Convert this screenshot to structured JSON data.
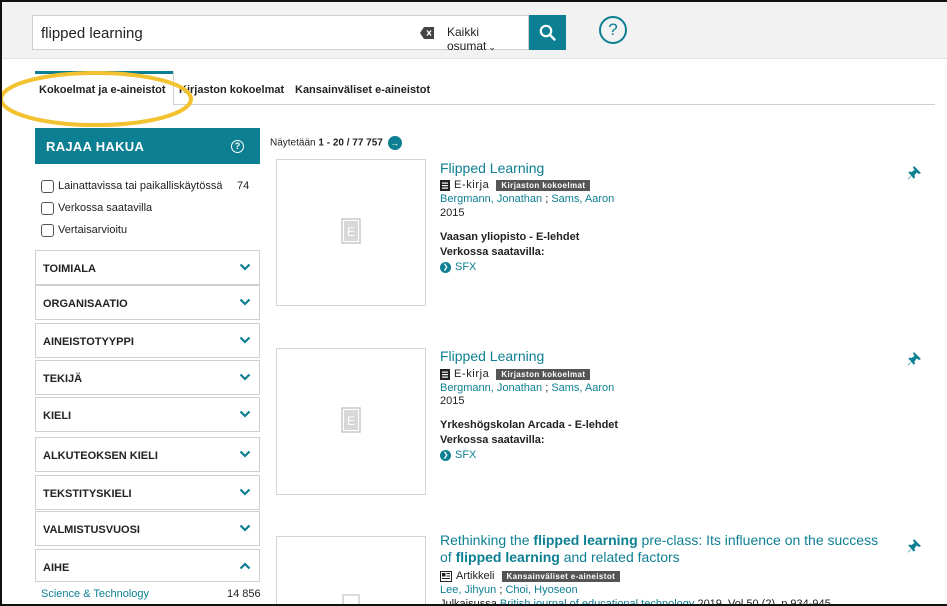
{
  "search": {
    "query": "flipped learning",
    "scope": "Kaikki osumat",
    "help_symbol": "?"
  },
  "tabs": [
    {
      "label": "Kokoelmat ja e-aineistot",
      "active": true
    },
    {
      "label": "Kirjaston kokoelmat",
      "active": false
    },
    {
      "label": "Kansainväliset e-aineistot",
      "active": false
    }
  ],
  "sidebar": {
    "title": "RAJAA HAKUA",
    "help_symbol": "?",
    "checkboxes": [
      {
        "label": "Lainattavissa tai paikalliskäytössä",
        "count": "74"
      },
      {
        "label": "Verkossa saatavilla",
        "count": ""
      },
      {
        "label": "Vertaisarvioitu",
        "count": ""
      }
    ],
    "facets": [
      {
        "label": "TOIMIALA",
        "expanded": false
      },
      {
        "label": "ORGANISAATIO",
        "expanded": false
      },
      {
        "label": "AINEISTOTYYPPI",
        "expanded": false
      },
      {
        "label": "TEKIJÄ",
        "expanded": false
      },
      {
        "label": "KIELI",
        "expanded": false
      },
      {
        "label": "ALKUTEOKSEN KIELI",
        "expanded": false
      },
      {
        "label": "TEKSTITYSKIELI",
        "expanded": false
      },
      {
        "label": "VALMISTUSVUOSI",
        "expanded": false
      },
      {
        "label": "AIHE",
        "expanded": true
      }
    ],
    "aihe_items": [
      {
        "label": "Science & Technology",
        "count": "14 856"
      }
    ]
  },
  "results": {
    "showing_prefix": "Näytetään",
    "showing_range": "1 - 20 / 77 757",
    "next_symbol": "→",
    "items": [
      {
        "title": "Flipped Learning",
        "format": "E-kirja",
        "collection": "Kirjaston kokoelmat",
        "author1": "Bergmann, Jonathan",
        "author2": "Sams, Aaron",
        "year": "2015",
        "holder": "Vaasan yliopisto - E-lehdet",
        "online_label": "Verkossa saatavilla:",
        "link": "SFX"
      },
      {
        "title": "Flipped Learning",
        "format": "E-kirja",
        "collection": "Kirjaston kokoelmat",
        "author1": "Bergmann, Jonathan",
        "author2": "Sams, Aaron",
        "year": "2015",
        "holder": "Yrkeshögskolan Arcada - E-lehdet",
        "online_label": "Verkossa saatavilla:",
        "link": "SFX"
      },
      {
        "title_part1": "Rethinking the ",
        "title_bold1": "flipped learning",
        "title_part2": " pre-class: Its influence on the success",
        "title_part3": "of ",
        "title_bold2": "flipped learning",
        "title_part4": " and related factors",
        "format": "Artikkeli",
        "collection": "Kansainväliset e-aineistot",
        "author1": "Lee, Jihyun",
        "author2": "Choi, Hyoseon",
        "pub_prefix": "Julkaisussa ",
        "journal": "British journal of educational technology",
        "pub_suffix": " 2019, Vol.50 (2), p.934-945"
      }
    ]
  },
  "colors": {
    "accent": "#0d7f93",
    "highlight": "#f2c230",
    "badge": "#555555"
  }
}
